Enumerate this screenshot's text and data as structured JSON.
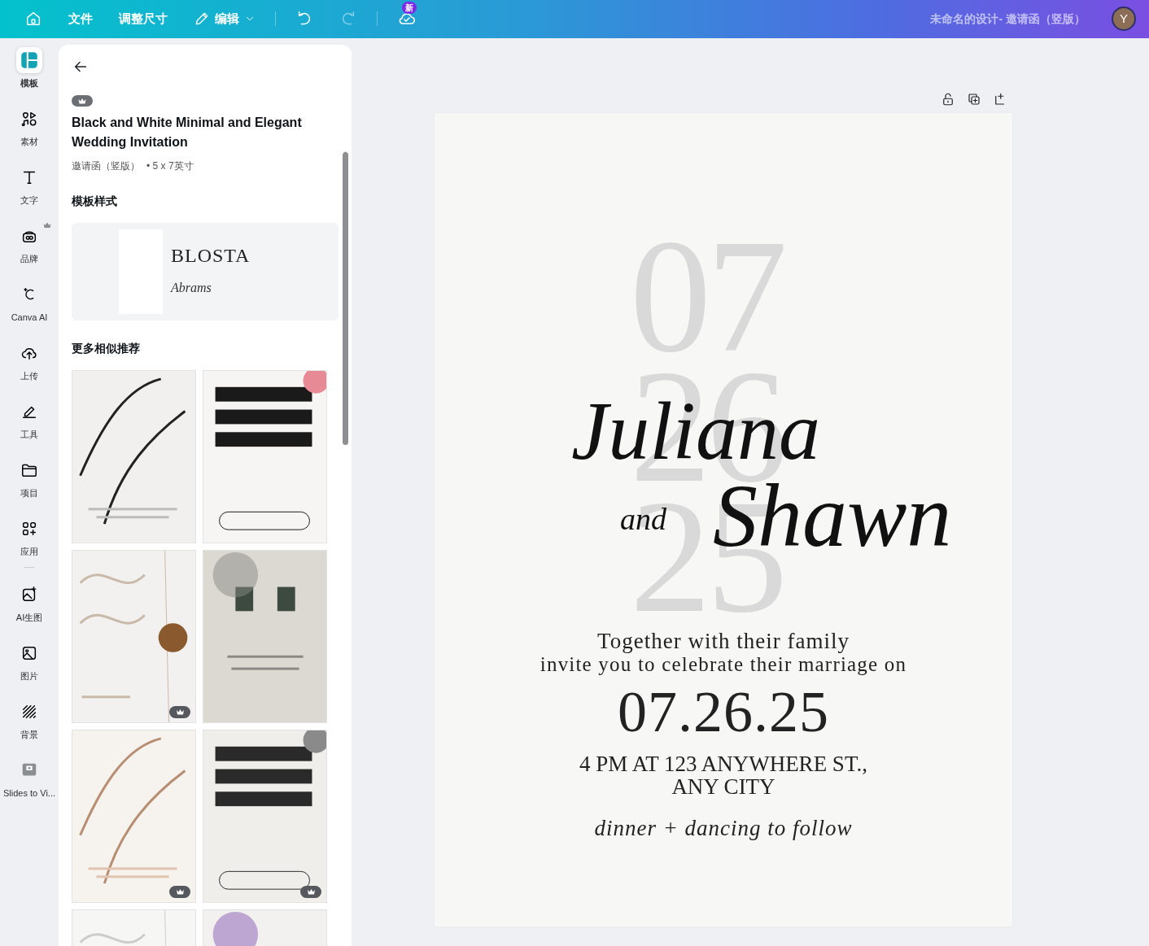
{
  "topbar": {
    "menu": [
      {
        "label": "文件",
        "kind": "text"
      },
      {
        "label": "调整尺寸",
        "kind": "text"
      },
      {
        "label": "编辑",
        "kind": "edit"
      }
    ],
    "redo_disabled": true,
    "save_badge": "新",
    "title": "未命名的设计- 邀请函（竖版）",
    "avatar": "Y"
  },
  "sidebar": {
    "items": [
      {
        "label": "模板",
        "selected": true,
        "premium": false
      },
      {
        "label": "素材",
        "selected": false,
        "premium": false
      },
      {
        "label": "文字",
        "selected": false,
        "premium": false
      },
      {
        "label": "品牌",
        "selected": false,
        "premium": true
      },
      {
        "label": "Canva AI",
        "selected": false,
        "premium": false
      },
      {
        "label": "上传",
        "selected": false,
        "premium": false
      },
      {
        "label": "工具",
        "selected": false,
        "premium": false
      },
      {
        "label": "项目",
        "selected": false,
        "premium": false
      },
      {
        "label": "应用",
        "selected": false,
        "premium": false
      },
      {
        "label": "AI生图",
        "selected": false,
        "premium": false
      },
      {
        "label": "图片",
        "selected": false,
        "premium": false
      },
      {
        "label": "背景",
        "selected": false,
        "premium": false
      },
      {
        "label": "Slides to Vi...",
        "selected": false,
        "premium": false
      }
    ]
  },
  "panel": {
    "premium": true,
    "title": "Black and White Minimal and Elegant Wedding Invitation",
    "type": "邀请函（竖版）",
    "size": "• 5 x 7英寸",
    "style_heading": "模板样式",
    "style_preview": {
      "font_sample": "BLOSTA",
      "script_sample": "Abrams"
    },
    "similar_heading": "更多相似推荐",
    "templates": [
      {
        "kind": "picture",
        "premium": false
      },
      {
        "kind": "picture",
        "premium": false
      },
      {
        "kind": "picture",
        "premium": true
      },
      {
        "kind": "picture",
        "premium": false
      },
      {
        "kind": "picture",
        "premium": true
      },
      {
        "kind": "picture",
        "premium": true
      },
      {
        "kind": "picture",
        "premium": false
      },
      {
        "kind": "picture",
        "premium": false
      }
    ]
  },
  "design": {
    "background_numbers": [
      "07",
      "26",
      "25"
    ],
    "name_1": "Juliana",
    "connector": "and",
    "name_2": "Shawn",
    "line_1": "Together with their family",
    "line_2": "invite you to celebrate their marriage on",
    "date": "07.26.25",
    "address_1": "4 PM AT 123 ANYWHERE ST.,",
    "address_2": "ANY CITY",
    "footer": "dinner + dancing to follow"
  }
}
